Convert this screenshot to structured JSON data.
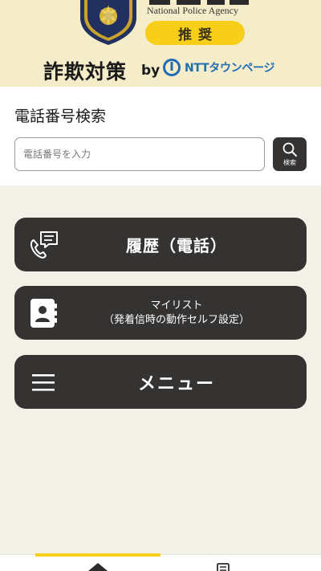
{
  "header": {
    "agency_en": "National Police Agency",
    "badge": "推奨",
    "title": "詐欺対策",
    "by": "by",
    "partner": "NTTタウンページ"
  },
  "search": {
    "title": "電話番号検索",
    "placeholder": "電話番号を入力",
    "button_label": "検索"
  },
  "menu": {
    "history_label": "履歴（電話）",
    "mylist_line1": "マイリスト",
    "mylist_line2": "（発着信時の動作セルフ設定）",
    "menu_label": "メニュー"
  },
  "colors": {
    "accent": "#f7cf1a",
    "button_bg": "#353332",
    "page_bg": "#f3f0e7",
    "partner_blue": "#1f6bb5"
  },
  "icons": {
    "emblem": "police-emblem-icon",
    "history": "phone-chat-icon",
    "mylist": "contact-book-icon",
    "menu": "hamburger-icon",
    "search": "search-icon"
  },
  "bottom_nav": {
    "active_index": 0
  }
}
